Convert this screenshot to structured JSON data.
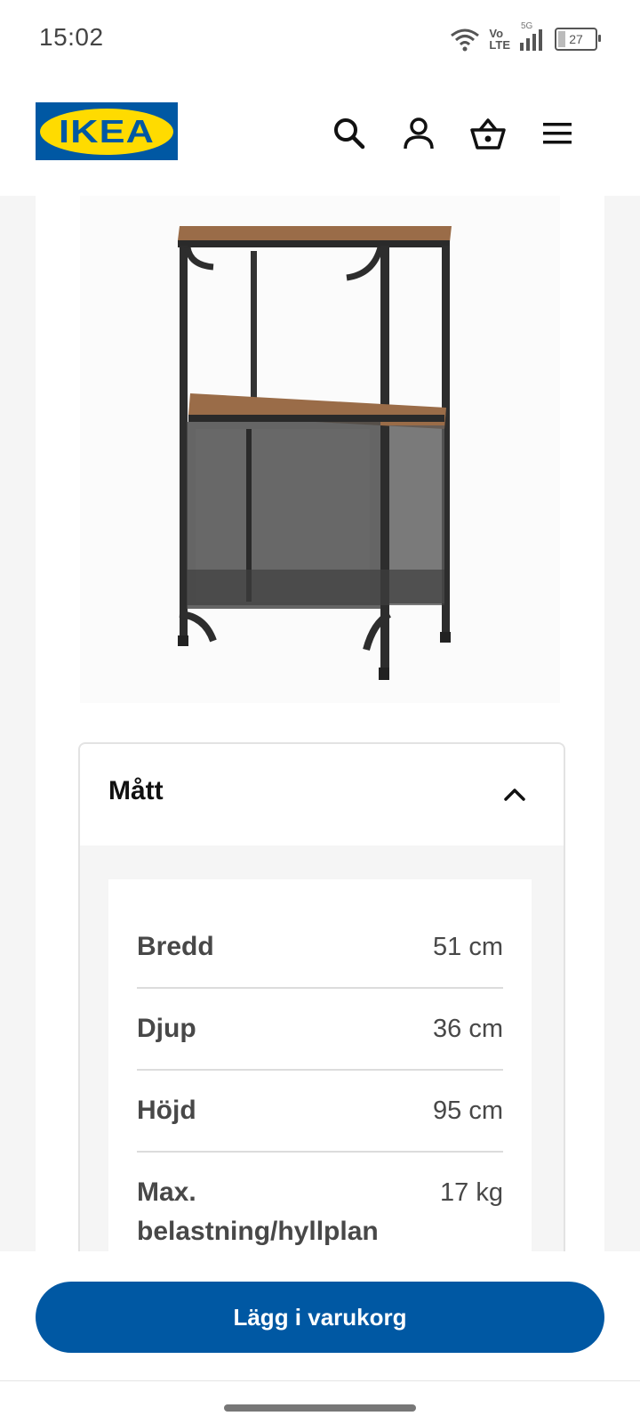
{
  "status_bar": {
    "time": "15:02",
    "network_top": "Vo",
    "network_bottom": "LTE",
    "network_gen": "5G",
    "battery": "27"
  },
  "header": {
    "logo_text": "IKEA",
    "icons": [
      "search-icon",
      "account-icon",
      "cart-icon",
      "menu-icon"
    ]
  },
  "product": {
    "image_alt": "bookshelf-product-image"
  },
  "dimensions": {
    "title": "Mått",
    "rows": [
      {
        "label": "Bredd",
        "value": "51 cm"
      },
      {
        "label": "Djup",
        "value": "36 cm"
      },
      {
        "label": "Höjd",
        "value": "95 cm"
      },
      {
        "label": "Max. belastning/hyllplan",
        "value": "17 kg"
      }
    ]
  },
  "cta": {
    "label": "Lägg i varukorg"
  },
  "colors": {
    "brand_blue": "#0058a3",
    "brand_yellow": "#ffdb00"
  }
}
